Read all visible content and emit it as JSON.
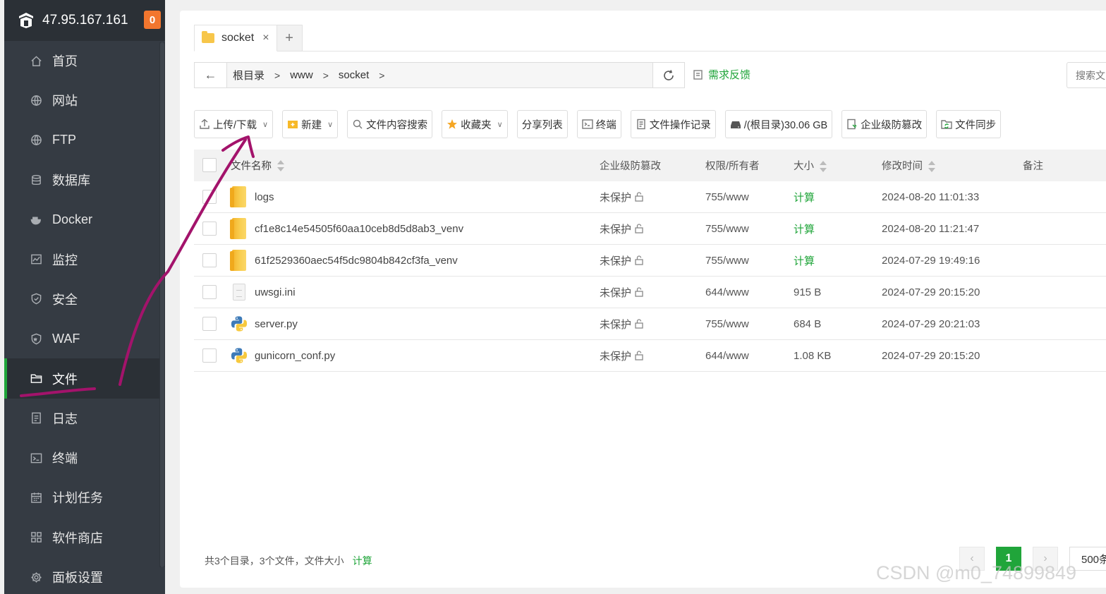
{
  "sidebar": {
    "server_ip": "47.95.167.161",
    "badge_count": "0",
    "items": [
      {
        "label": "首页",
        "icon": "home-icon"
      },
      {
        "label": "网站",
        "icon": "globe-icon"
      },
      {
        "label": "FTP",
        "icon": "ftp-globe-icon"
      },
      {
        "label": "数据库",
        "icon": "database-icon"
      },
      {
        "label": "Docker",
        "icon": "docker-icon"
      },
      {
        "label": "监控",
        "icon": "monitor-icon"
      },
      {
        "label": "安全",
        "icon": "shield-icon"
      },
      {
        "label": "WAF",
        "icon": "waf-shield-icon"
      },
      {
        "label": "文件",
        "icon": "folder-icon",
        "active": true
      },
      {
        "label": "日志",
        "icon": "log-icon"
      },
      {
        "label": "终端",
        "icon": "terminal-icon"
      },
      {
        "label": "计划任务",
        "icon": "calendar-icon"
      },
      {
        "label": "软件商店",
        "icon": "apps-icon"
      },
      {
        "label": "面板设置",
        "icon": "gear-icon"
      }
    ]
  },
  "tabs": [
    {
      "label": "socket",
      "close": "×"
    }
  ],
  "tab_add": "+",
  "path": {
    "back": "←",
    "crumbs": [
      "根目录",
      "www",
      "socket"
    ],
    "feedback": "需求反馈",
    "search_placeholder": "搜索文"
  },
  "toolbar": {
    "upload": "上传/下载",
    "new": "新建",
    "content_search": "文件内容搜索",
    "favorites": "收藏夹",
    "share_list": "分享列表",
    "terminal": "终端",
    "op_log": "文件操作记录",
    "disk": "/(根目录)30.06 GB",
    "tamper": "企业级防篡改",
    "sync": "文件同步"
  },
  "table": {
    "headers": {
      "name": "文件名称",
      "protect": "企业级防篡改",
      "perm": "权限/所有者",
      "size": "大小",
      "mtime": "修改时间",
      "note": "备注"
    },
    "rows": [
      {
        "name": "logs",
        "type": "folder",
        "protect": "未保护",
        "perm": "755/www",
        "size": "计算",
        "size_link": true,
        "mtime": "2024-08-20 11:01:33"
      },
      {
        "name": "cf1e8c14e54505f60aa10ceb8d5d8ab3_venv",
        "type": "folder",
        "protect": "未保护",
        "perm": "755/www",
        "size": "计算",
        "size_link": true,
        "mtime": "2024-08-20 11:21:47"
      },
      {
        "name": "61f2529360aec54f5dc9804b842cf3fa_venv",
        "type": "folder",
        "protect": "未保护",
        "perm": "755/www",
        "size": "计算",
        "size_link": true,
        "mtime": "2024-07-29 19:49:16"
      },
      {
        "name": "uwsgi.ini",
        "type": "file",
        "protect": "未保护",
        "perm": "644/www",
        "size": "915 B",
        "size_link": false,
        "mtime": "2024-07-29 20:15:20"
      },
      {
        "name": "server.py",
        "type": "python",
        "protect": "未保护",
        "perm": "755/www",
        "size": "684 B",
        "size_link": false,
        "mtime": "2024-07-29 20:21:03"
      },
      {
        "name": "gunicorn_conf.py",
        "type": "python",
        "protect": "未保护",
        "perm": "644/www",
        "size": "1.08 KB",
        "size_link": false,
        "mtime": "2024-07-29 20:15:20"
      }
    ]
  },
  "footer": {
    "summary": "共3个目录，3个文件，文件大小",
    "calc": "计算"
  },
  "pager": {
    "prev": "‹",
    "current": "1",
    "next": "›",
    "size": "500条"
  },
  "watermark": "CSDN @m0_74899849",
  "colors": {
    "accent": "#20a53a",
    "sidebar": "#353b43",
    "annotation": "#a3136b"
  }
}
